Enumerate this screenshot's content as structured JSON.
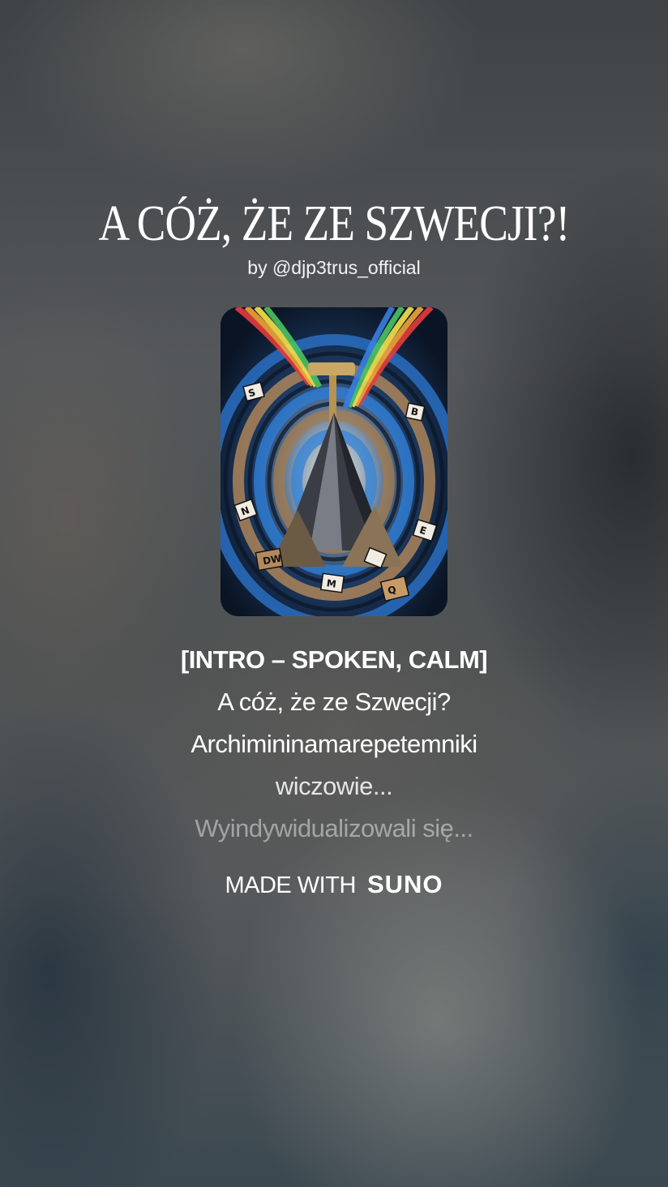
{
  "song": {
    "title": "A CÓŻ, ŻE ZE SZWECJI?!",
    "byline": "by @djp3trus_official"
  },
  "cover_art": {
    "icon": "album-cover-art"
  },
  "lyrics": {
    "section": "[INTRO – SPOKEN, CALM]",
    "lines": [
      "A cóż, że ze Szwecji?",
      "Archimininamarepetemniki",
      "wiczowie...",
      "Wyindywidualizowali się..."
    ]
  },
  "branding": {
    "made_with": "MADE WITH",
    "logo_text": "SUNO"
  }
}
